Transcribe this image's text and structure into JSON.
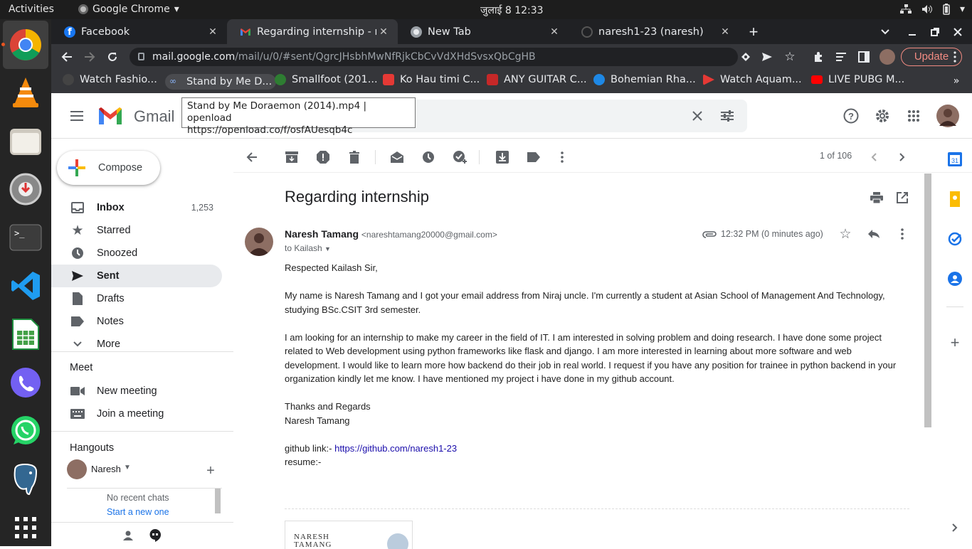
{
  "system": {
    "activities": "Activities",
    "app_name": "Google Chrome",
    "clock": "जुलाई 8  12:33"
  },
  "dock": [
    "chrome-icon",
    "vlc-icon",
    "files-icon",
    "disk-utility-icon",
    "terminal-icon",
    "vscode-icon",
    "libreoffice-calc-icon",
    "viber-icon",
    "whatsapp-icon",
    "postgresql-icon",
    "apps-grid-icon"
  ],
  "tabs": [
    {
      "title": "Facebook",
      "close": "✕"
    },
    {
      "title": "Regarding internship - na",
      "close": "✕"
    },
    {
      "title": "New Tab",
      "close": "✕"
    },
    {
      "title": "naresh1-23 (naresh)",
      "close": "✕"
    }
  ],
  "omnibox": {
    "host": "mail.google.com",
    "path": "/mail/u/0/#sent/QgrcJHsbhMwNfRjkCbCvVdXHdSvsxQbCgHB",
    "update": "Update"
  },
  "bookmarks": [
    "Watch Fashio...",
    "Stand by Me D...",
    "Smallfoot (201...",
    "Ko Hau timi C...",
    "ANY GUITAR C...",
    "Bohemian Rha...",
    "Watch Aquam...",
    "LIVE PUBG M..."
  ],
  "tooltip": {
    "line1": "Stand by Me Doraemon (2014).mp4 | openload",
    "line2": "https://openload.co/f/osfAUesqb4c"
  },
  "gmail": {
    "logo": "Gmail",
    "compose": "Compose",
    "nav": [
      {
        "label": "Inbox",
        "count": "1,253"
      },
      {
        "label": "Starred",
        "count": ""
      },
      {
        "label": "Snoozed",
        "count": ""
      },
      {
        "label": "Sent",
        "count": ""
      },
      {
        "label": "Drafts",
        "count": ""
      },
      {
        "label": "Notes",
        "count": ""
      },
      {
        "label": "More",
        "count": ""
      }
    ],
    "meet": {
      "heading": "Meet",
      "new": "New meeting",
      "join": "Join a meeting"
    },
    "hangouts": {
      "heading": "Hangouts",
      "user": "Naresh",
      "no_chats": "No recent chats",
      "start": "Start a new one"
    },
    "pager": "1 of 106"
  },
  "email": {
    "subject": "Regarding internship",
    "from_name": "Naresh Tamang",
    "from_email": "<nareshtamang20000@gmail.com>",
    "to": "to Kailash",
    "time": "12:32 PM (0 minutes ago)",
    "greeting": "Respected Kailash Sir,",
    "p1": "My name is Naresh Tamang and I got your email address from Niraj uncle. I'm currently a student at Asian School of Management And Technology, studying BSc.CSIT 3rd semester.",
    "p2": "I am looking for an internship to make my career in the field of IT. I am interested in solving problem and doing research. I have done some project related to Web development using python frameworks like flask and django. I am more interested in learning about more software and web development. I would like to learn more how backend do their job in real world. I request if you have any position for trainee in python backend in your organization kindly let me know. I have mentioned my project i have done in my github account.",
    "thanks": "Thanks and Regards",
    "sign": "Naresh Tamang",
    "github_label": "github link:- ",
    "github_url": "https://github.com/naresh1-23",
    "resume": "resume:-",
    "attach_name": "NARESH TAMANG"
  }
}
